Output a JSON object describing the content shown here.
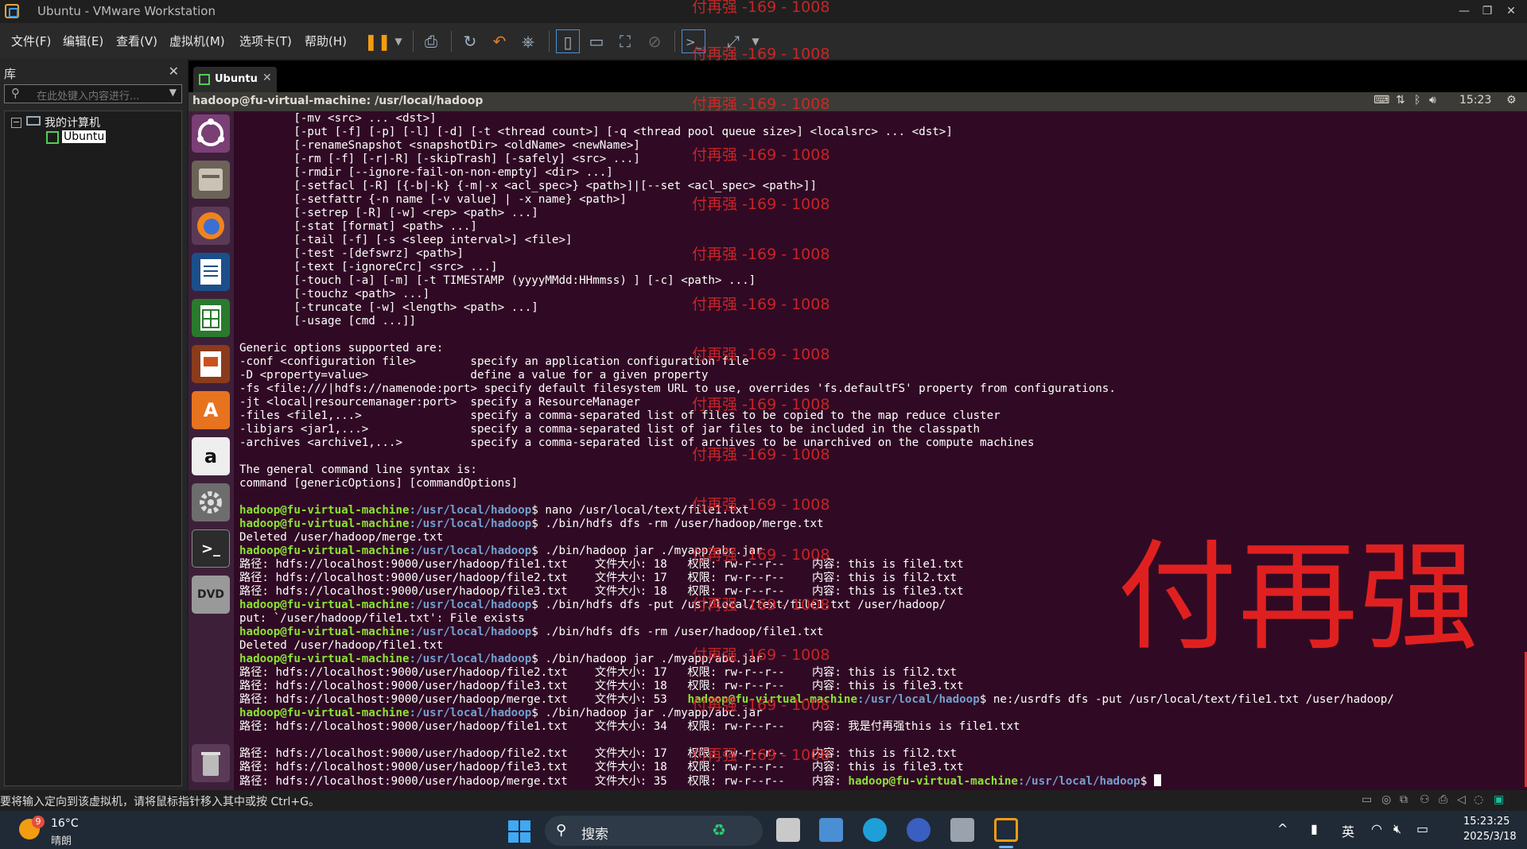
{
  "window": {
    "title": "Ubuntu - VMware Workstation",
    "minimize": "—",
    "restore": "❐",
    "close": "✕"
  },
  "menubar": {
    "items": [
      "文件(F)",
      "编辑(E)",
      "查看(V)",
      "虚拟机(M)",
      "选项卡(T)",
      "帮助(H)"
    ],
    "toolbar_icons": [
      "pause-icon",
      "send-keys-icon",
      "snapshot-icon",
      "revert-snapshot-icon",
      "snapshot-manager-icon",
      "show-library-icon",
      "show-thumbnail-icon",
      "full-screen-icon",
      "unity-icon",
      "console-view-icon",
      "stretch-icon"
    ]
  },
  "library": {
    "title": "库",
    "close": "✕",
    "search_placeholder": "在此处键入内容进行...",
    "tree": {
      "root_label": "我的计算机",
      "expander": "−",
      "child_label": "Ubuntu"
    }
  },
  "tab": {
    "label": "Ubuntu",
    "close": "✕"
  },
  "ubuntu_bar": {
    "path": "hadoop@fu-virtual-machine: /usr/local/hadoop",
    "time": "15:23",
    "indicators": [
      "keyboard-icon",
      "network-arrows-icon",
      "bluetooth-icon",
      "volume-icon",
      "settings-gear-icon"
    ]
  },
  "launcher": {
    "items": [
      "ubuntu-dash-icon",
      "files-icon",
      "firefox-icon",
      "writer-icon",
      "calc-icon",
      "impress-icon",
      "software-center-icon",
      "amazon-icon",
      "system-settings-icon",
      "terminal-icon",
      "dvd-icon",
      "trash-icon"
    ],
    "amazon_glyph": "a",
    "terminal_glyph": ">_",
    "dvd_glyph": "DVD"
  },
  "terminal": {
    "prompt_user": "hadoop@fu-virtual-machine",
    "prompt_path": ":/usr/local/hadoop",
    "prompt_end": "$ ",
    "lines": [
      {
        "t": "        [-mv <src> ... <dst>]"
      },
      {
        "t": "        [-put [-f] [-p] [-l] [-d] [-t <thread count>] [-q <thread pool queue size>] <localsrc> ... <dst>]"
      },
      {
        "t": "        [-renameSnapshot <snapshotDir> <oldName> <newName>]"
      },
      {
        "t": "        [-rm [-f] [-r|-R] [-skipTrash] [-safely] <src> ...]"
      },
      {
        "t": "        [-rmdir [--ignore-fail-on-non-empty] <dir> ...]"
      },
      {
        "t": "        [-setfacl [-R] [{-b|-k} {-m|-x <acl_spec>} <path>]|[--set <acl_spec> <path>]]"
      },
      {
        "t": "        [-setfattr {-n name [-v value] | -x name} <path>]"
      },
      {
        "t": "        [-setrep [-R] [-w] <rep> <path> ...]"
      },
      {
        "t": "        [-stat [format] <path> ...]"
      },
      {
        "t": "        [-tail [-f] [-s <sleep interval>] <file>]"
      },
      {
        "t": "        [-test -[defswrz] <path>]"
      },
      {
        "t": "        [-text [-ignoreCrc] <src> ...]"
      },
      {
        "t": "        [-touch [-a] [-m] [-t TIMESTAMP (yyyyMMdd:HHmmss) ] [-c] <path> ...]"
      },
      {
        "t": "        [-touchz <path> ...]"
      },
      {
        "t": "        [-truncate [-w] <length> <path> ...]"
      },
      {
        "t": "        [-usage [cmd ...]]"
      },
      {
        "t": ""
      },
      {
        "t": "Generic options supported are:"
      },
      {
        "t": "-conf <configuration file>        specify an application configuration file"
      },
      {
        "t": "-D <property=value>               define a value for a given property"
      },
      {
        "t": "-fs <file:///|hdfs://namenode:port> specify default filesystem URL to use, overrides 'fs.defaultFS' property from configurations."
      },
      {
        "t": "-jt <local|resourcemanager:port>  specify a ResourceManager"
      },
      {
        "t": "-files <file1,...>                specify a comma-separated list of files to be copied to the map reduce cluster"
      },
      {
        "t": "-libjars <jar1,...>               specify a comma-separated list of jar files to be included in the classpath"
      },
      {
        "t": "-archives <archive1,...>          specify a comma-separated list of archives to be unarchived on the compute machines"
      },
      {
        "t": ""
      },
      {
        "t": "The general command line syntax is:"
      },
      {
        "t": "command [genericOptions] [commandOptions]"
      },
      {
        "t": ""
      },
      {
        "p": true,
        "t": "nano /usr/local/text/file1.txt"
      },
      {
        "p": true,
        "t": "./bin/hdfs dfs -rm /user/hadoop/merge.txt"
      },
      {
        "t": "Deleted /user/hadoop/merge.txt"
      },
      {
        "p": true,
        "t": "./bin/hadoop jar ./myapp/abc.jar"
      },
      {
        "t": "路径: hdfs://localhost:9000/user/hadoop/file1.txt    文件大小: 18   权限: rw-r--r--    内容: this is file1.txt"
      },
      {
        "t": "路径: hdfs://localhost:9000/user/hadoop/file2.txt    文件大小: 17   权限: rw-r--r--    内容: this is fil2.txt"
      },
      {
        "t": "路径: hdfs://localhost:9000/user/hadoop/file3.txt    文件大小: 18   权限: rw-r--r--    内容: this is file3.txt"
      },
      {
        "p": true,
        "t": "./bin/hdfs dfs -put /usr/local/text/file1.txt /user/hadoop/"
      },
      {
        "t": "put: `/user/hadoop/file1.txt': File exists"
      },
      {
        "p": true,
        "t": "./bin/hdfs dfs -rm /user/hadoop/file1.txt"
      },
      {
        "t": "Deleted /user/hadoop/file1.txt"
      },
      {
        "p": true,
        "t": "./bin/hadoop jar ./myapp/abc.jar"
      },
      {
        "t": "路径: hdfs://localhost:9000/user/hadoop/file2.txt    文件大小: 17   权限: rw-r--r--    内容: this is fil2.txt"
      },
      {
        "t": "路径: hdfs://localhost:9000/user/hadoop/file3.txt    文件大小: 18   权限: rw-r--r--    内容: this is file3.txt"
      },
      {
        "t": "路径: hdfs://localhost:9000/user/hadoop/merge.txt    文件大小: 53   ",
        "tp": true,
        "t2": "ne:/usrdfs dfs -put /usr/local/text/file1.txt /user/hadoop/"
      },
      {
        "p": true,
        "t": "./bin/hadoop jar ./myapp/abc.jar"
      },
      {
        "t": "路径: hdfs://localhost:9000/user/hadoop/file1.txt    文件大小: 34   权限: rw-r--r--    内容: 我是付再强this is file1.txt"
      },
      {
        "t": ""
      },
      {
        "t": "路径: hdfs://localhost:9000/user/hadoop/file2.txt    文件大小: 17   权限: rw-r--r--    内容: this is fil2.txt"
      },
      {
        "t": "路径: hdfs://localhost:9000/user/hadoop/file3.txt    文件大小: 18   权限: rw-r--r--    内容: this is file3.txt"
      },
      {
        "t": "路径: hdfs://localhost:9000/user/hadoop/merge.txt    文件大小: 35   权限: rw-r--r--    内容: ",
        "tp": true,
        "t2": "",
        "cursor": true
      }
    ]
  },
  "watermark": {
    "text": "付再强 -169 - 1008",
    "big_text": "付再强",
    "color": "#e02020"
  },
  "statusbar": {
    "message": "要将输入定向到该虚拟机，请将鼠标指针移入其中或按 Ctrl+G。",
    "icons": [
      "hdd-icon",
      "cd-icon",
      "network-icon",
      "usb-icon",
      "printer-icon",
      "sound-icon",
      "display-icon",
      "message-icon"
    ]
  },
  "taskbar": {
    "weather_badge": "9",
    "temperature": "16°C",
    "condition": "晴朗",
    "search_label": "搜索",
    "apps": [
      "file-explorer-icon",
      "photos-icon",
      "edge-icon",
      "app-icon",
      "app-window-icon",
      "vmware-icon"
    ],
    "tray": {
      "chevron": "^",
      "pinned": "▮",
      "ime": "英",
      "wifi": "wifi-icon",
      "sound": "mute-icon",
      "battery": "battery-icon"
    },
    "time": "15:23:25",
    "date": "2025/3/18"
  }
}
